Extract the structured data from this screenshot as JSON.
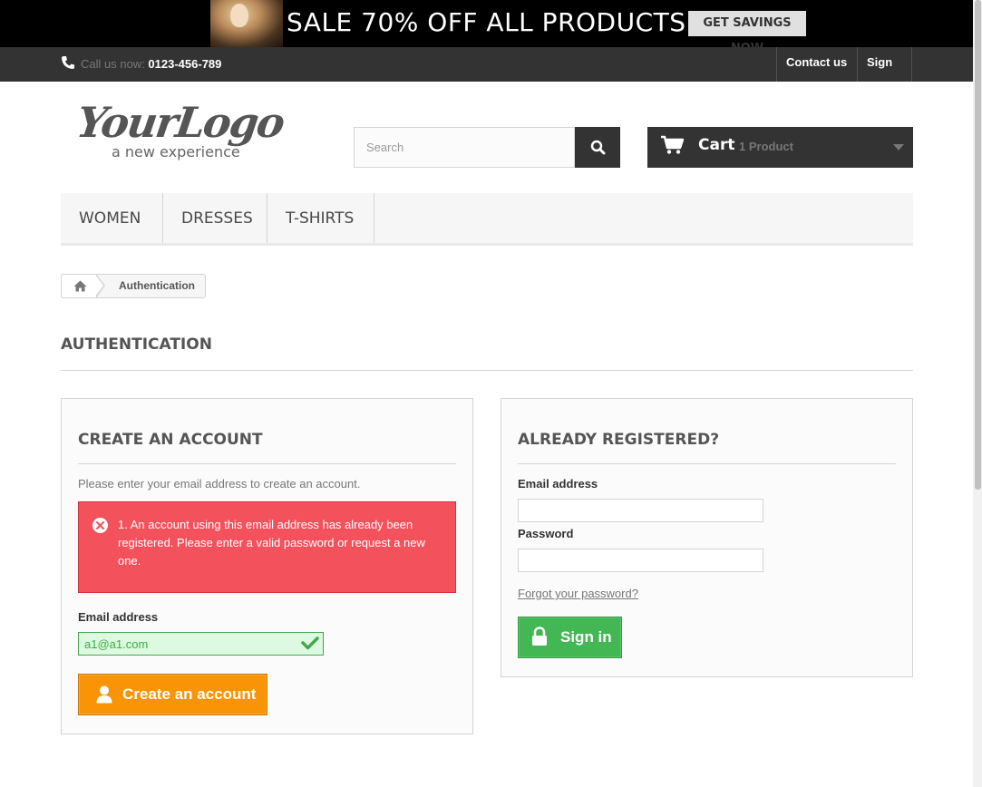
{
  "banner": {
    "text": "SALE 70% OFF ALL PRODUCTS",
    "button_label": "GET SAVINGS NOW"
  },
  "navbar": {
    "phone_prefix": "Call us now: ",
    "phone_number": "0123-456-789",
    "contact_label": "Contact us",
    "signin_label": "Sign in"
  },
  "logo": {
    "main": "YourLogo",
    "tagline": "a new experience"
  },
  "search": {
    "placeholder": "Search"
  },
  "cart": {
    "label": "Cart",
    "count": "1 Product"
  },
  "menu": {
    "items": [
      "WOMEN",
      "DRESSES",
      "T-SHIRTS"
    ]
  },
  "breadcrumb": {
    "current": "Authentication"
  },
  "page": {
    "heading": "AUTHENTICATION"
  },
  "create_account": {
    "title": "CREATE AN ACCOUNT",
    "intro": "Please enter your email address to create an account.",
    "error": "1. An account using this email address has already been registered. Please enter a valid password or request a new one.",
    "email_label": "Email address",
    "email_value": "a1@a1.com",
    "button_label": "Create an account"
  },
  "login": {
    "title": "ALREADY REGISTERED?",
    "email_label": "Email address",
    "email_value": "",
    "password_label": "Password",
    "password_value": "",
    "forgot_label": "Forgot your password?",
    "button_label": "Sign in"
  },
  "colors": {
    "dark": "#333333",
    "error": "#f3515c",
    "success": "#43b754",
    "warning": "#f89406"
  }
}
